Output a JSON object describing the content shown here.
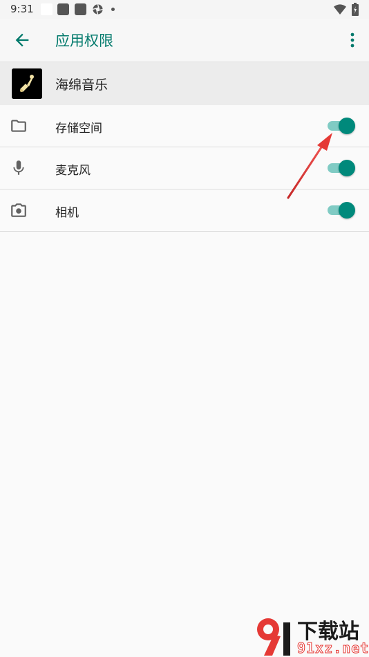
{
  "status_bar": {
    "time": "9:31"
  },
  "app_bar": {
    "title": "应用权限",
    "back_icon": "arrow-back-icon",
    "menu_icon": "more-vert-icon"
  },
  "app": {
    "name": "海绵音乐"
  },
  "permissions": [
    {
      "label": "存储空间",
      "icon": "folder-icon",
      "enabled": true
    },
    {
      "label": "麦克风",
      "icon": "microphone-icon",
      "enabled": true
    },
    {
      "label": "相机",
      "icon": "camera-icon",
      "enabled": true
    }
  ],
  "colors": {
    "accent": "#00796b",
    "toggle_thumb": "#00897b",
    "toggle_track": "#80cbc4",
    "annotation_arrow": "#e53935"
  },
  "watermark": {
    "top": "下载站",
    "bottom": "91xz.net"
  }
}
